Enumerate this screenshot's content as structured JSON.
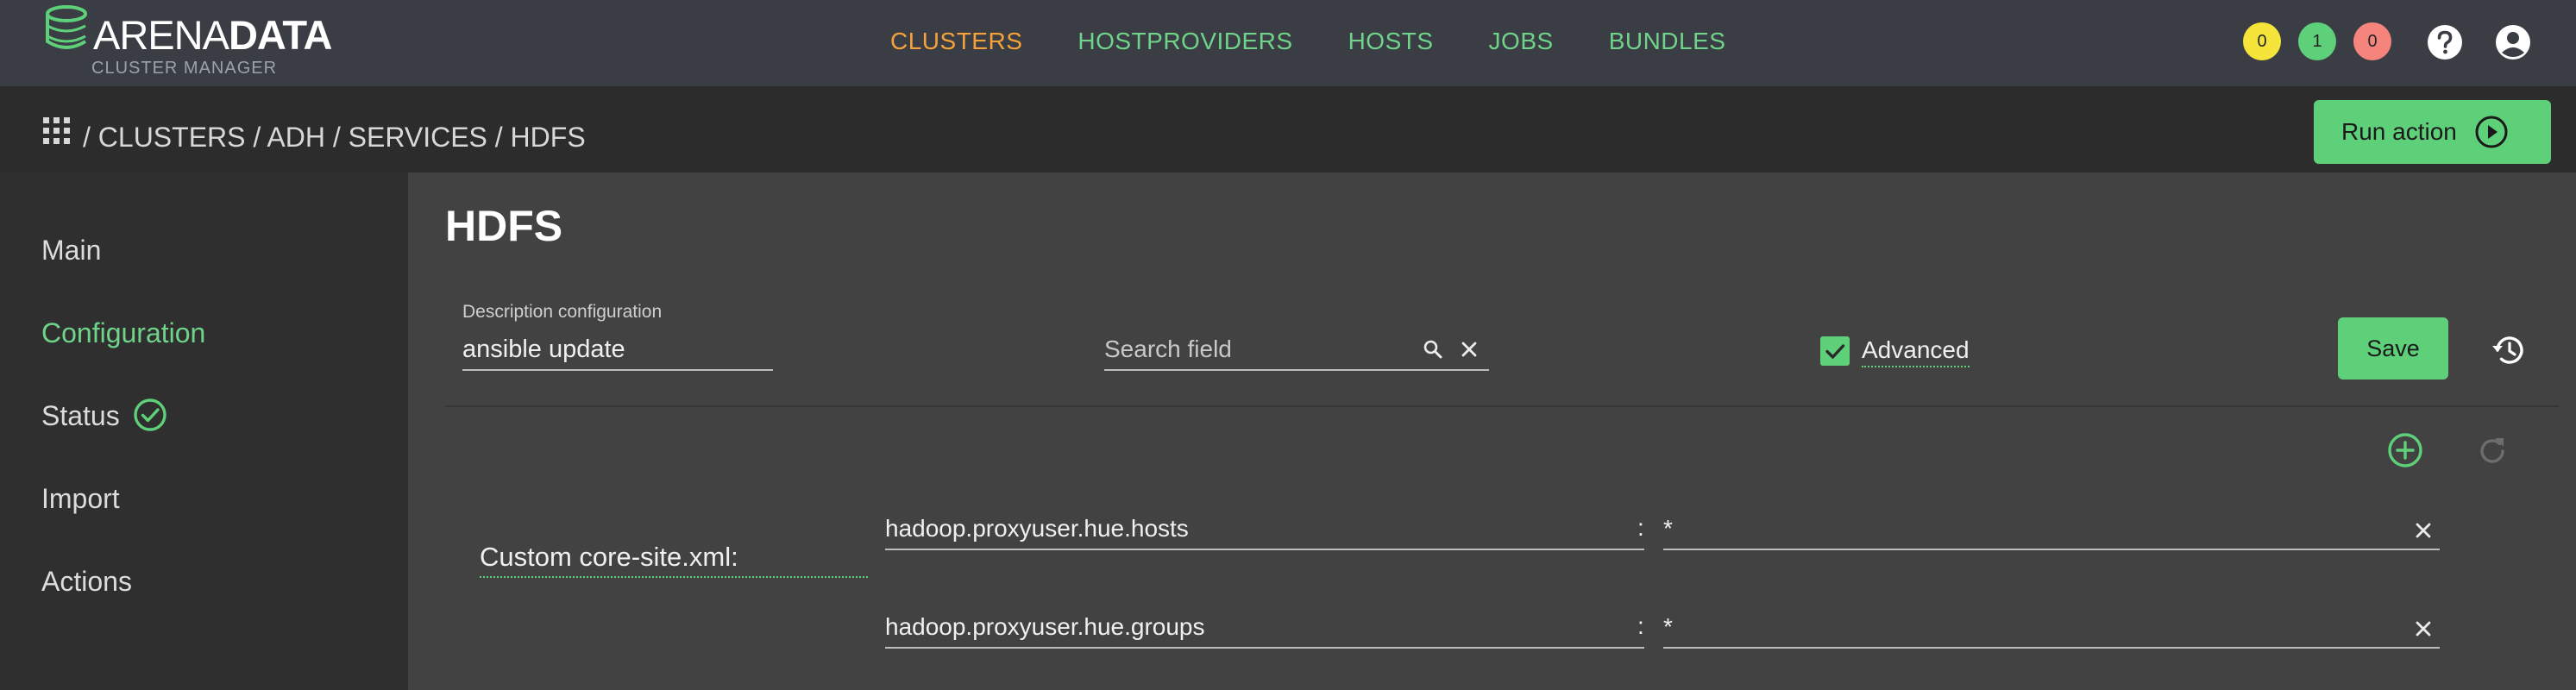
{
  "logo": {
    "word_a": "ARENA",
    "word_b": "DATA",
    "subtitle": "CLUSTER MANAGER"
  },
  "topnav": {
    "items": [
      {
        "label": "CLUSTERS",
        "active": true
      },
      {
        "label": "HOSTPROVIDERS",
        "active": false
      },
      {
        "label": "HOSTS",
        "active": false
      },
      {
        "label": "JOBS",
        "active": false
      },
      {
        "label": "BUNDLES",
        "active": false
      }
    ],
    "badges": [
      {
        "value": "0",
        "color": "#f5e43a"
      },
      {
        "value": "1",
        "color": "#5fd07a"
      },
      {
        "value": "0",
        "color": "#f4847c"
      }
    ],
    "icons": [
      "help-icon",
      "account-icon"
    ]
  },
  "breadcrumb": {
    "sep": "/",
    "items": [
      "CLUSTERS",
      "ADH",
      "SERVICES",
      "HDFS"
    ],
    "run_action_label": "Run action"
  },
  "sidebar": {
    "items": [
      {
        "label": "Main",
        "active": false
      },
      {
        "label": "Configuration",
        "active": true
      },
      {
        "label": "Status",
        "active": false
      },
      {
        "label": "Import",
        "active": false
      },
      {
        "label": "Actions",
        "active": false
      }
    ]
  },
  "main": {
    "title": "HDFS",
    "description": {
      "label": "Description configuration",
      "value": "ansible update"
    },
    "search": {
      "placeholder": "Search field",
      "value": ""
    },
    "advanced": {
      "label": "Advanced",
      "checked": true
    },
    "save_label": "Save",
    "group": {
      "label": "Custom core-site.xml:",
      "separator": ":",
      "rows": [
        {
          "key": "hadoop.proxyuser.hue.hosts",
          "value": "*"
        },
        {
          "key": "hadoop.proxyuser.hue.groups",
          "value": "*"
        }
      ]
    }
  },
  "colors": {
    "accent_green": "#5fd07a",
    "active_orange": "#f5a23a",
    "topbar_bg": "#3a3d44",
    "breadcrumb_bg": "#2c2c2c",
    "sidebar_bg": "#2f2f2f",
    "content_bg": "#424242"
  }
}
